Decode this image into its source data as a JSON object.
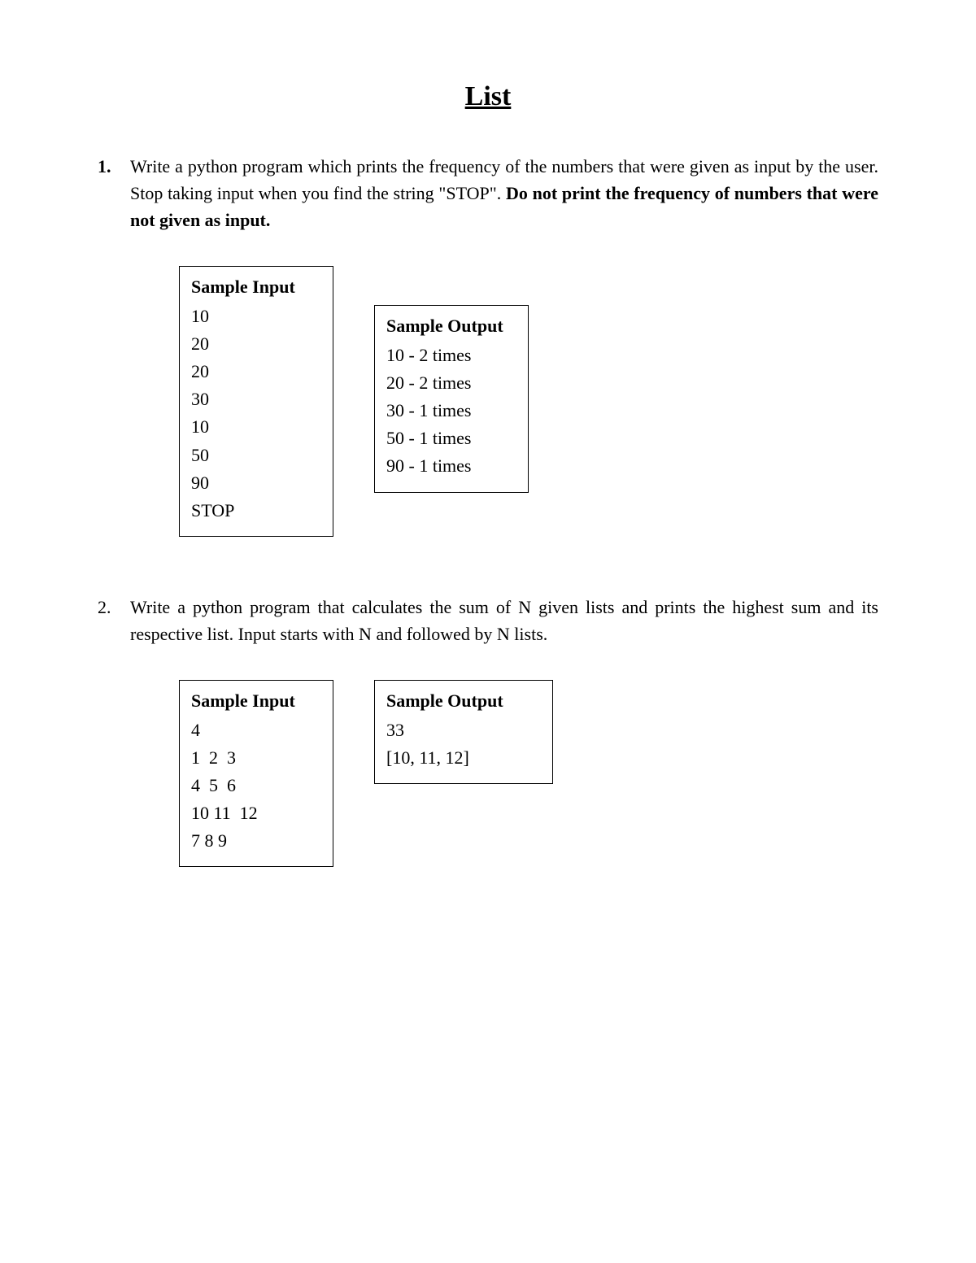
{
  "title": "List",
  "questions": [
    {
      "number": "1.",
      "number_bold": true,
      "text_plain": "Write a python program which prints the frequency of the numbers that were given as input by the user. Stop taking input when you find the string \"STOP\". ",
      "text_bold": "Do not print the frequency of numbers that were not given as input.",
      "sample_input_title": "Sample Input",
      "sample_input_lines": [
        "10",
        "20",
        "20",
        "30",
        "10",
        "50",
        "90",
        "STOP"
      ],
      "sample_output_title": "Sample Output",
      "sample_output_lines": [
        "10 - 2 times",
        "20 - 2 times",
        "30 - 1 times",
        "50 - 1 times",
        "90 - 1 times"
      ]
    },
    {
      "number": "2.",
      "number_bold": false,
      "text_plain": "Write a python program that calculates the sum of N given lists and prints  the highest sum and its respective list. Input starts with N and followed by N lists.",
      "text_bold": "",
      "sample_input_title": "Sample Input",
      "sample_input_lines": [
        "4",
        "1  2  3",
        "4  5  6",
        "10 11  12",
        "7 8 9"
      ],
      "sample_output_title": "Sample Output",
      "sample_output_lines": [
        "33",
        "[10, 11, 12]"
      ]
    }
  ]
}
